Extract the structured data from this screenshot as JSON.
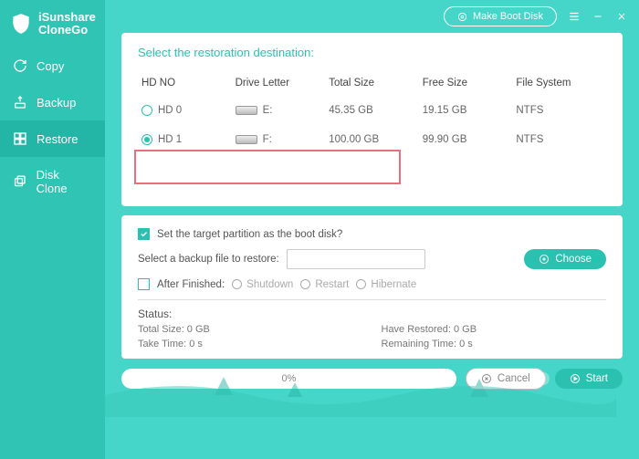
{
  "app": {
    "name": "iSunshare\nCloneGo"
  },
  "titlebar": {
    "boot_label": "Make Boot Disk"
  },
  "sidebar": {
    "items": [
      {
        "label": "Copy"
      },
      {
        "label": "Backup"
      },
      {
        "label": "Restore"
      },
      {
        "label": "Disk Clone"
      }
    ]
  },
  "destination": {
    "title": "Select the restoration destination:",
    "headers": {
      "hdno": "HD NO",
      "drive": "Drive Letter",
      "total": "Total Size",
      "free": "Free Size",
      "fs": "File System"
    },
    "rows": [
      {
        "id": "HD 0",
        "letter": "E:",
        "total": "45.35 GB",
        "free": "19.15 GB",
        "fs": "NTFS",
        "selected": false
      },
      {
        "id": "HD 1",
        "letter": "F:",
        "total": "100.00 GB",
        "free": "99.90 GB",
        "fs": "NTFS",
        "selected": true
      }
    ]
  },
  "options": {
    "boot_checkbox": "Set the target partition as the boot disk?",
    "backup_label": "Select a backup file to restore:",
    "backup_value": "",
    "choose_label": "Choose",
    "after_label": "After Finished:",
    "after_opts": [
      "Shutdown",
      "Restart",
      "Hibernate"
    ]
  },
  "status": {
    "label": "Status:",
    "total": "Total Size: 0 GB",
    "restored": "Have Restored: 0 GB",
    "take": "Take Time: 0 s",
    "remain": "Remaining Time: 0 s"
  },
  "progress": {
    "percent": "0%"
  },
  "buttons": {
    "cancel": "Cancel",
    "start": "Start"
  }
}
